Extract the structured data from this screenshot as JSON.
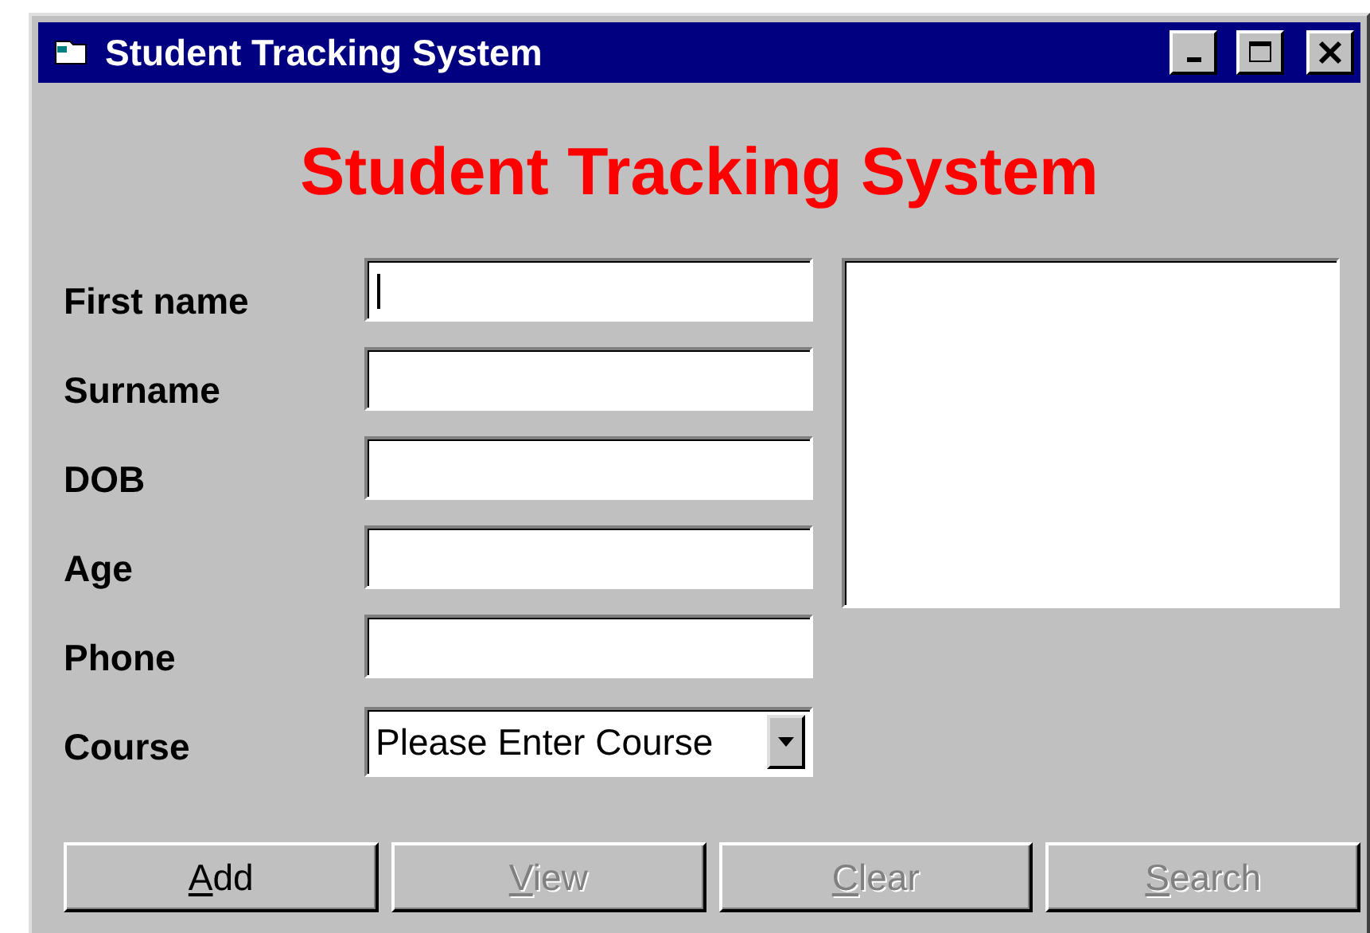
{
  "window": {
    "title": "Student Tracking System"
  },
  "heading": "Student Tracking System",
  "fields": [
    {
      "label": "First name",
      "focused": true
    },
    {
      "label": "Surname",
      "focused": false
    },
    {
      "label": "DOB",
      "focused": false
    },
    {
      "label": "Age",
      "focused": false
    },
    {
      "label": "Phone",
      "focused": false
    }
  ],
  "course": {
    "label": "Course",
    "value": "Please Enter Course"
  },
  "buttons": [
    {
      "label": "Add",
      "disabled": false
    },
    {
      "label": "View",
      "disabled": true
    },
    {
      "label": "Clear",
      "disabled": true
    },
    {
      "label": "Search",
      "disabled": true
    }
  ]
}
